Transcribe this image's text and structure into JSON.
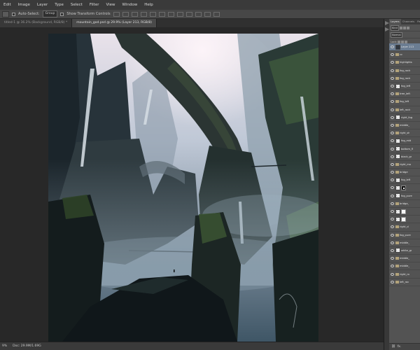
{
  "menu": [
    "Edit",
    "Image",
    "Layer",
    "Type",
    "Select",
    "Filter",
    "View",
    "Window",
    "Help"
  ],
  "options": {
    "auto_select_label": "Auto-Select:",
    "group_value": "Group",
    "transform_label": "Show Transform Controls"
  },
  "tabs": [
    {
      "label": "titled-1 @ 36.2% (Background, RGB/8) *",
      "active": false
    },
    {
      "label": "mountain_god.psd @ 29.9% (Layer 213, RGB/8)",
      "active": true
    }
  ],
  "status": {
    "zoom": "9%",
    "doc": "Doc: 29.9M/1.69G"
  },
  "panel": {
    "tabs": [
      "Layers",
      "Channels",
      "Paths"
    ],
    "kind": "Kind",
    "blend_mode": "Normal",
    "lock_label": "Lock:",
    "fx_label": "fx."
  },
  "layers": [
    {
      "name": "Layer 213",
      "type": "photo",
      "selected": true
    },
    {
      "name": "cc",
      "type": "folder"
    },
    {
      "name": "highlights",
      "type": "folder"
    },
    {
      "name": "fog_rock",
      "type": "folder"
    },
    {
      "name": "fog_rock",
      "type": "folder"
    },
    {
      "name": "fog_left",
      "type": "layer"
    },
    {
      "name": "tree_left",
      "type": "folder"
    },
    {
      "name": "fog_left",
      "type": "folder"
    },
    {
      "name": "left_rock",
      "type": "folder"
    },
    {
      "name": "right_fog",
      "type": "layer"
    },
    {
      "name": "middle_",
      "type": "folder"
    },
    {
      "name": "right_sh",
      "type": "folder"
    },
    {
      "name": "fog_mid",
      "type": "layer"
    },
    {
      "name": "bottom_fl",
      "type": "layer"
    },
    {
      "name": "black_gr",
      "type": "layer"
    },
    {
      "name": "right_mo",
      "type": "folder"
    },
    {
      "name": "bridge",
      "type": "folder"
    },
    {
      "name": "fog_left",
      "type": "layer"
    },
    {
      "name": "",
      "type": "mask"
    },
    {
      "name": "fog_pure",
      "type": "layer"
    },
    {
      "name": "bridge_",
      "type": "folder"
    },
    {
      "name": "",
      "type": "maskwhite"
    },
    {
      "name": "",
      "type": "maskwhite"
    },
    {
      "name": "right_cl",
      "type": "folder"
    },
    {
      "name": "fog_pure",
      "type": "folder"
    },
    {
      "name": "middle_",
      "type": "folder"
    },
    {
      "name": "white_gr",
      "type": "layer"
    },
    {
      "name": "middle_",
      "type": "folder"
    },
    {
      "name": "middle_",
      "type": "folder"
    },
    {
      "name": "right_ro",
      "type": "folder"
    },
    {
      "name": "left_roc",
      "type": "folder"
    }
  ],
  "colors": {
    "menubar": "#3a3a3a",
    "optionsbar": "#474747",
    "panel": "#535353",
    "selected_layer": "#6b7d92",
    "workspace": "#282828"
  }
}
